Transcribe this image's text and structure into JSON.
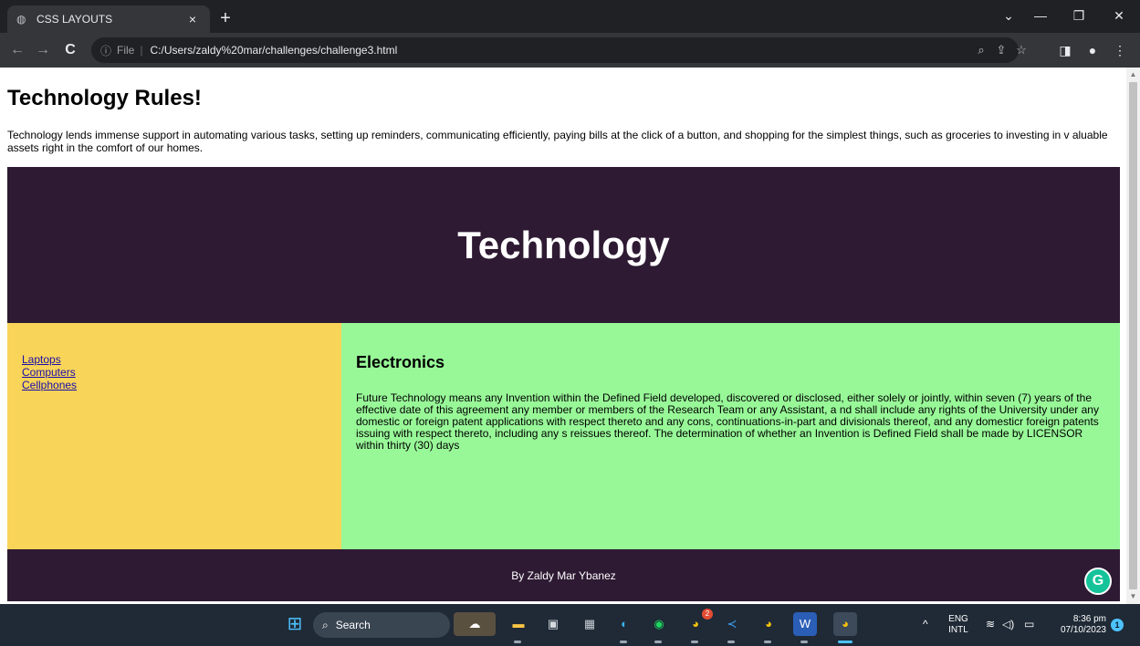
{
  "browser": {
    "tab": {
      "title": "CSS LAYOUTS",
      "close": "×",
      "new_tab": "+"
    },
    "window_controls": {
      "minimize": "—",
      "restore": "❐",
      "close": "✕",
      "dropdown": "⌄"
    },
    "address_bar": {
      "scheme_label": "File",
      "url": "C:/Users/zaldy%20mar/challenges/challenge3.html"
    }
  },
  "page": {
    "heading": "Technology Rules!",
    "intro": "Technology lends immense support in automating various tasks, setting up reminders, communicating efficiently, paying bills at the click of a button, and shopping for the simplest things, such as groceries to investing in v aluable assets right in the comfort of our homes.",
    "hero_title": "Technology",
    "sidebar_links": [
      "Laptops",
      "Computers",
      "Cellphones"
    ],
    "content_heading": "Electronics",
    "content_text": "Future Technology means any Invention within the Defined Field developed, discovered or disclosed, either solely or jointly, within seven (7) years of the effective date of this agreement any member or members of the Research Team or any Assistant, a nd shall include any rights of the University under any domestic or foreign patent applications with respect thereto and any cons, continuations-in-part and divisionals thereof, and any domesticr foreign patents issuing with respect thereto, including any s reissues thereof. The determination of whether an Invention is Defined Field shall be made by LICENSOR within thirty (30) days",
    "footer": "By Zaldy Mar Ybanez",
    "colors": {
      "hero": "#2e1a33",
      "sidebar": "#f8d458",
      "content": "#98f898",
      "footer": "#2e1a33"
    }
  },
  "taskbar": {
    "search_label": "Search",
    "language": "ENG",
    "keyboard": "INTL",
    "time": "8:36 pm",
    "date": "07/10/2023",
    "notification_count": "1",
    "chrome_badge": "2",
    "app_icons": [
      "windows-start-icon",
      "search-icon",
      "widgets-icon",
      "file-explorer-icon",
      "microsoft-store-icon",
      "calculator-icon",
      "edge-icon",
      "spotify-icon",
      "chrome-icon",
      "vscode-icon",
      "chrome-profile-icon",
      "word-icon",
      "chrome-active-icon"
    ]
  }
}
